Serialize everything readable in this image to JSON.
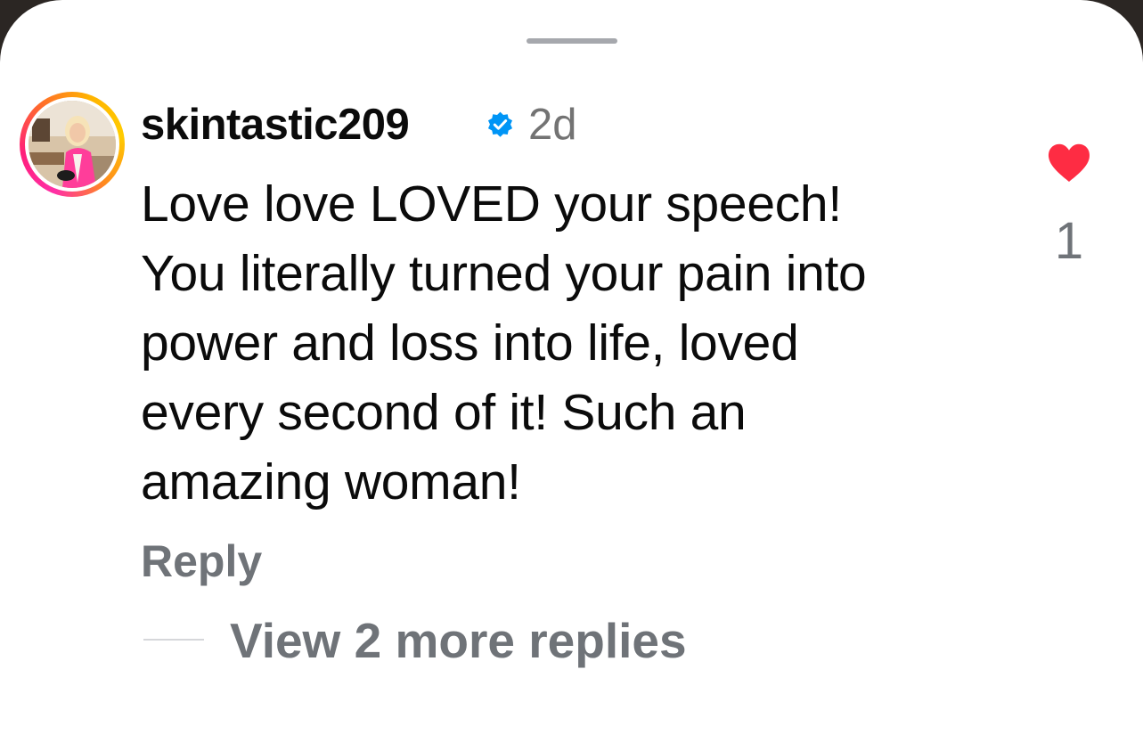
{
  "comment": {
    "username": "skintastic209",
    "verified_icon": "verified-badge-icon",
    "timestamp": "2d",
    "text_lines": [
      "Love love LOVED your speech!",
      "You literally turned your pain into",
      "power and loss into life, loved",
      "every second of it! Such an",
      "amazing woman!"
    ],
    "reply_label": "Reply",
    "view_more_replies_label": "View 2 more replies",
    "like": {
      "icon": "heart-filled-icon",
      "count": "1",
      "liked": true
    }
  },
  "colors": {
    "heart": "#fe2c43",
    "verified": "#0095f6",
    "secondary_text": "#6f7378"
  }
}
